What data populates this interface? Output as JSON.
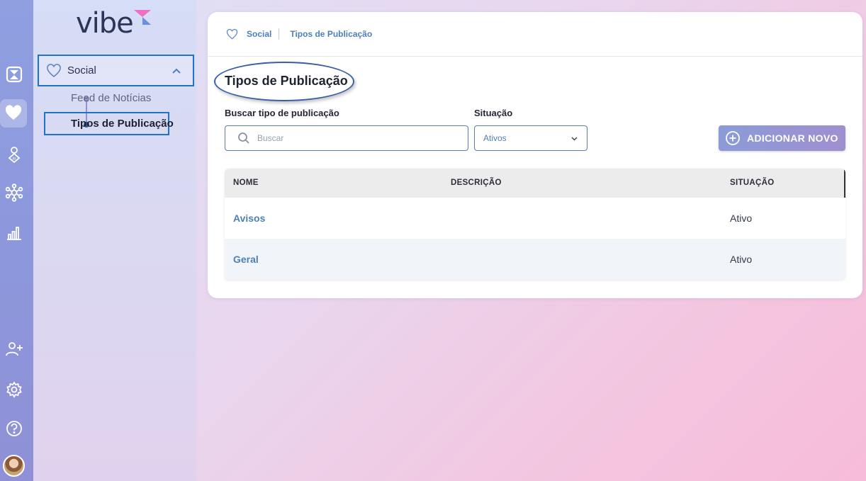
{
  "app": {
    "logo_text": "vibe"
  },
  "sidebar": {
    "section_label": "Social",
    "items": [
      {
        "label": "Feed de Notícias",
        "active": false
      },
      {
        "label": "Tipos de Publicação",
        "active": true
      }
    ]
  },
  "breadcrumb": {
    "items": [
      "Social",
      "Tipos de Publicação"
    ]
  },
  "page": {
    "title": "Tipos de Publicação",
    "search_label": "Buscar tipo de publicação",
    "search_placeholder": "Buscar",
    "status_label": "Situação",
    "status_selected": "Ativos",
    "add_button_label": "ADICIONAR NOVO"
  },
  "table": {
    "columns": [
      "NOME",
      "DESCRIÇÃO",
      "SITUAÇÃO"
    ],
    "rows": [
      {
        "nome": "Avisos",
        "descricao": "",
        "situacao": "Ativo"
      },
      {
        "nome": "Geral",
        "descricao": "",
        "situacao": "Ativo"
      }
    ]
  },
  "colors": {
    "accent": "#4f7fb8",
    "highlight_border": "#1f73c9",
    "rail": "#8f9fe0",
    "logo_pink": "#f16fc0",
    "logo_blue": "#6b8ee0"
  }
}
